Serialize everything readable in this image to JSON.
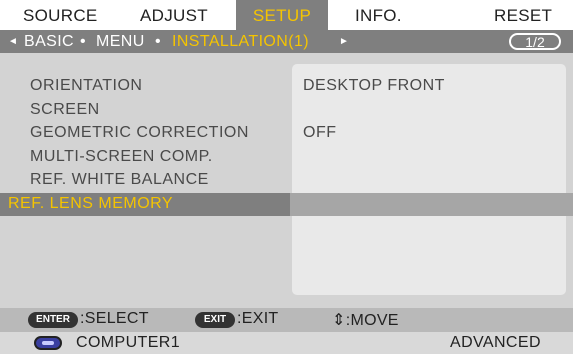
{
  "tabs": [
    {
      "label": "SOURCE"
    },
    {
      "label": "ADJUST"
    },
    {
      "label": "SETUP"
    },
    {
      "label": "INFO."
    },
    {
      "label": "RESET"
    }
  ],
  "breadcrumb": {
    "left_arrow": "◄",
    "items": [
      "BASIC",
      "MENU",
      "INSTALLATION(1)"
    ],
    "separator": "•",
    "right_arrow": "►",
    "page": "1/2"
  },
  "menu": {
    "items": [
      {
        "label": "ORIENTATION",
        "value": "DESKTOP FRONT"
      },
      {
        "label": "SCREEN",
        "value": ""
      },
      {
        "label": "GEOMETRIC CORRECTION",
        "value": "OFF"
      },
      {
        "label": "MULTI-SCREEN COMP.",
        "value": ""
      },
      {
        "label": "REF. WHITE BALANCE",
        "value": ""
      },
      {
        "label": "REF. LENS MEMORY",
        "value": ""
      }
    ]
  },
  "help": {
    "enter_key": "ENTER",
    "select": ":SELECT",
    "exit_key": "EXIT",
    "exit": ":EXIT",
    "move": "⇕:MOVE"
  },
  "status": {
    "source": "COMPUTER1",
    "mode": "ADVANCED"
  },
  "colors": {
    "highlight": "#f5c400",
    "bar": "#7f7f7f",
    "panel": "#d3d3d3"
  }
}
